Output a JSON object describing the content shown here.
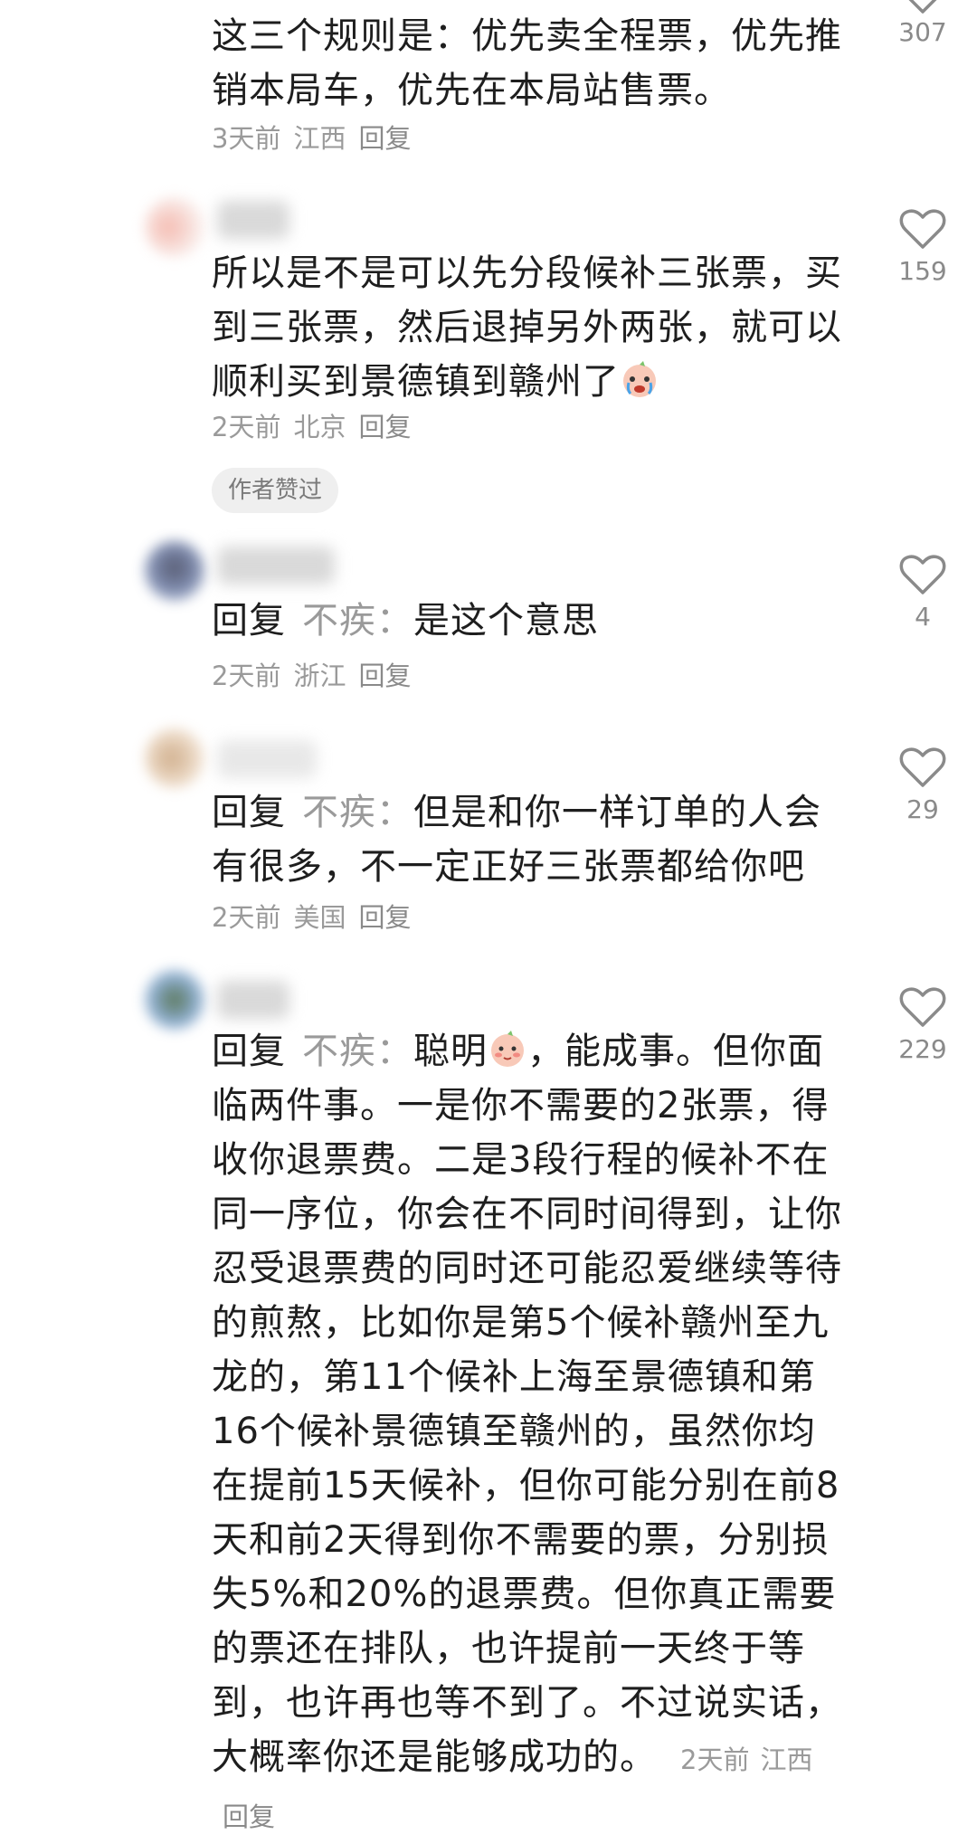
{
  "comments": [
    {
      "text": "这三个规则是：优先卖全程票，优先推销本局车，优先在本局站售票。",
      "time": "3天前",
      "location": "江西",
      "reply": "回复",
      "likes": "307"
    },
    {
      "text": "所以是不是可以先分段候补三张票，买到三张票，然后退掉另外两张，就可以顺利买到景德镇到赣州了",
      "emoji": "crying-face-icon",
      "time": "2天前",
      "location": "北京",
      "reply": "回复",
      "likes": "159",
      "badge": "作者赞过"
    },
    {
      "prefix": "回复",
      "target": "不疾：",
      "text": "是这个意思",
      "time": "2天前",
      "location": "浙江",
      "reply": "回复",
      "likes": "4"
    },
    {
      "prefix": "回复",
      "target": "不疾：",
      "text": "但是和你一样订单的人会有很多，不一定正好三张票都给你吧",
      "time": "2天前",
      "location": "美国",
      "reply": "回复",
      "likes": "29"
    },
    {
      "prefix": "回复",
      "target": "不疾：",
      "text_a": "聪明",
      "emoji": "blushing-face-icon",
      "text_b": "，能成事。但你面临两件事。一是你不需要的2张票，得收你退票费。二是3段行程的候补不在同一序位，你会在不同时间得到，让你忍受退票费的同时还可能忍爱继续等待的煎熬，比如你是第5个候补赣州至九龙的，第11个候补上海至景德镇和第16个候补景德镇至赣州的，虽然你均在提前15天候补，但你可能分别在前8天和前2天得到你不需要的票，分别损失5%和20%的退票费。但你真正需要的票还在排队，也许提前一天终于等到，也许再也等不到了。不过说实话，大概率你还是能够成功的。",
      "time": "2天前",
      "location": "江西",
      "reply": "回复",
      "likes": "229"
    }
  ]
}
